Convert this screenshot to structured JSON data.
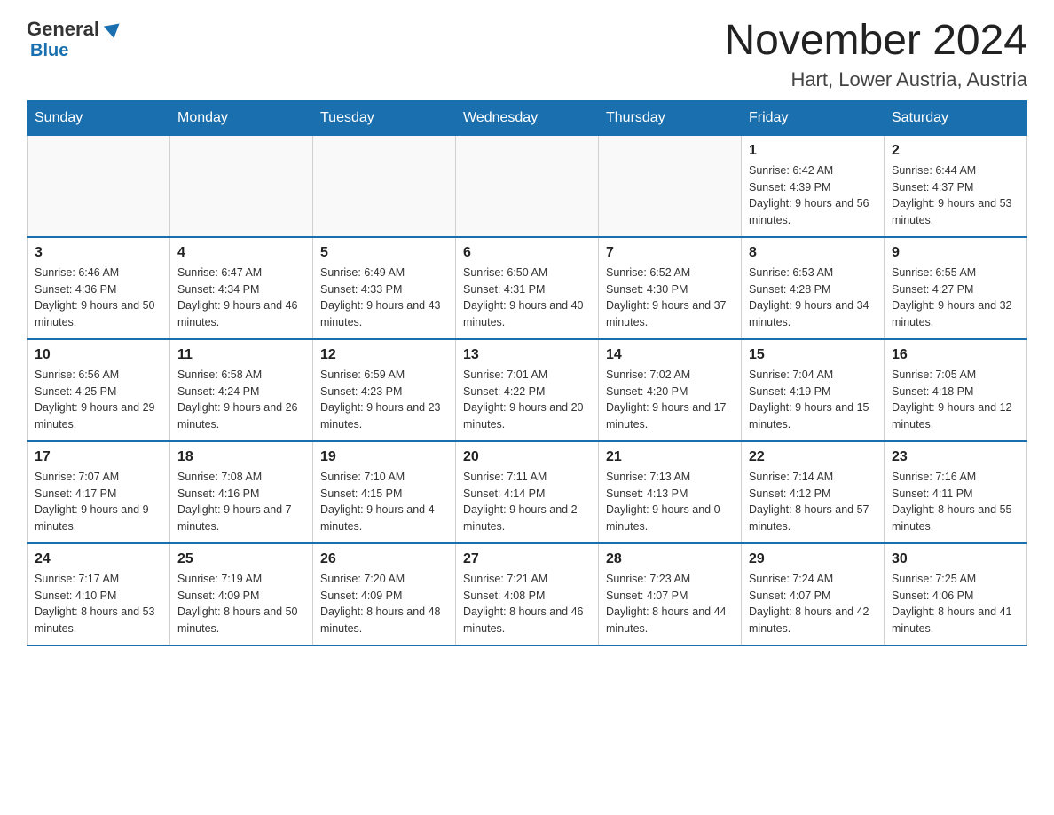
{
  "header": {
    "logo_general": "General",
    "logo_blue": "Blue",
    "title": "November 2024",
    "subtitle": "Hart, Lower Austria, Austria"
  },
  "days_of_week": [
    "Sunday",
    "Monday",
    "Tuesday",
    "Wednesday",
    "Thursday",
    "Friday",
    "Saturday"
  ],
  "weeks": [
    [
      {
        "day": "",
        "info": ""
      },
      {
        "day": "",
        "info": ""
      },
      {
        "day": "",
        "info": ""
      },
      {
        "day": "",
        "info": ""
      },
      {
        "day": "",
        "info": ""
      },
      {
        "day": "1",
        "info": "Sunrise: 6:42 AM\nSunset: 4:39 PM\nDaylight: 9 hours and 56 minutes."
      },
      {
        "day": "2",
        "info": "Sunrise: 6:44 AM\nSunset: 4:37 PM\nDaylight: 9 hours and 53 minutes."
      }
    ],
    [
      {
        "day": "3",
        "info": "Sunrise: 6:46 AM\nSunset: 4:36 PM\nDaylight: 9 hours and 50 minutes."
      },
      {
        "day": "4",
        "info": "Sunrise: 6:47 AM\nSunset: 4:34 PM\nDaylight: 9 hours and 46 minutes."
      },
      {
        "day": "5",
        "info": "Sunrise: 6:49 AM\nSunset: 4:33 PM\nDaylight: 9 hours and 43 minutes."
      },
      {
        "day": "6",
        "info": "Sunrise: 6:50 AM\nSunset: 4:31 PM\nDaylight: 9 hours and 40 minutes."
      },
      {
        "day": "7",
        "info": "Sunrise: 6:52 AM\nSunset: 4:30 PM\nDaylight: 9 hours and 37 minutes."
      },
      {
        "day": "8",
        "info": "Sunrise: 6:53 AM\nSunset: 4:28 PM\nDaylight: 9 hours and 34 minutes."
      },
      {
        "day": "9",
        "info": "Sunrise: 6:55 AM\nSunset: 4:27 PM\nDaylight: 9 hours and 32 minutes."
      }
    ],
    [
      {
        "day": "10",
        "info": "Sunrise: 6:56 AM\nSunset: 4:25 PM\nDaylight: 9 hours and 29 minutes."
      },
      {
        "day": "11",
        "info": "Sunrise: 6:58 AM\nSunset: 4:24 PM\nDaylight: 9 hours and 26 minutes."
      },
      {
        "day": "12",
        "info": "Sunrise: 6:59 AM\nSunset: 4:23 PM\nDaylight: 9 hours and 23 minutes."
      },
      {
        "day": "13",
        "info": "Sunrise: 7:01 AM\nSunset: 4:22 PM\nDaylight: 9 hours and 20 minutes."
      },
      {
        "day": "14",
        "info": "Sunrise: 7:02 AM\nSunset: 4:20 PM\nDaylight: 9 hours and 17 minutes."
      },
      {
        "day": "15",
        "info": "Sunrise: 7:04 AM\nSunset: 4:19 PM\nDaylight: 9 hours and 15 minutes."
      },
      {
        "day": "16",
        "info": "Sunrise: 7:05 AM\nSunset: 4:18 PM\nDaylight: 9 hours and 12 minutes."
      }
    ],
    [
      {
        "day": "17",
        "info": "Sunrise: 7:07 AM\nSunset: 4:17 PM\nDaylight: 9 hours and 9 minutes."
      },
      {
        "day": "18",
        "info": "Sunrise: 7:08 AM\nSunset: 4:16 PM\nDaylight: 9 hours and 7 minutes."
      },
      {
        "day": "19",
        "info": "Sunrise: 7:10 AM\nSunset: 4:15 PM\nDaylight: 9 hours and 4 minutes."
      },
      {
        "day": "20",
        "info": "Sunrise: 7:11 AM\nSunset: 4:14 PM\nDaylight: 9 hours and 2 minutes."
      },
      {
        "day": "21",
        "info": "Sunrise: 7:13 AM\nSunset: 4:13 PM\nDaylight: 9 hours and 0 minutes."
      },
      {
        "day": "22",
        "info": "Sunrise: 7:14 AM\nSunset: 4:12 PM\nDaylight: 8 hours and 57 minutes."
      },
      {
        "day": "23",
        "info": "Sunrise: 7:16 AM\nSunset: 4:11 PM\nDaylight: 8 hours and 55 minutes."
      }
    ],
    [
      {
        "day": "24",
        "info": "Sunrise: 7:17 AM\nSunset: 4:10 PM\nDaylight: 8 hours and 53 minutes."
      },
      {
        "day": "25",
        "info": "Sunrise: 7:19 AM\nSunset: 4:09 PM\nDaylight: 8 hours and 50 minutes."
      },
      {
        "day": "26",
        "info": "Sunrise: 7:20 AM\nSunset: 4:09 PM\nDaylight: 8 hours and 48 minutes."
      },
      {
        "day": "27",
        "info": "Sunrise: 7:21 AM\nSunset: 4:08 PM\nDaylight: 8 hours and 46 minutes."
      },
      {
        "day": "28",
        "info": "Sunrise: 7:23 AM\nSunset: 4:07 PM\nDaylight: 8 hours and 44 minutes."
      },
      {
        "day": "29",
        "info": "Sunrise: 7:24 AM\nSunset: 4:07 PM\nDaylight: 8 hours and 42 minutes."
      },
      {
        "day": "30",
        "info": "Sunrise: 7:25 AM\nSunset: 4:06 PM\nDaylight: 8 hours and 41 minutes."
      }
    ]
  ]
}
